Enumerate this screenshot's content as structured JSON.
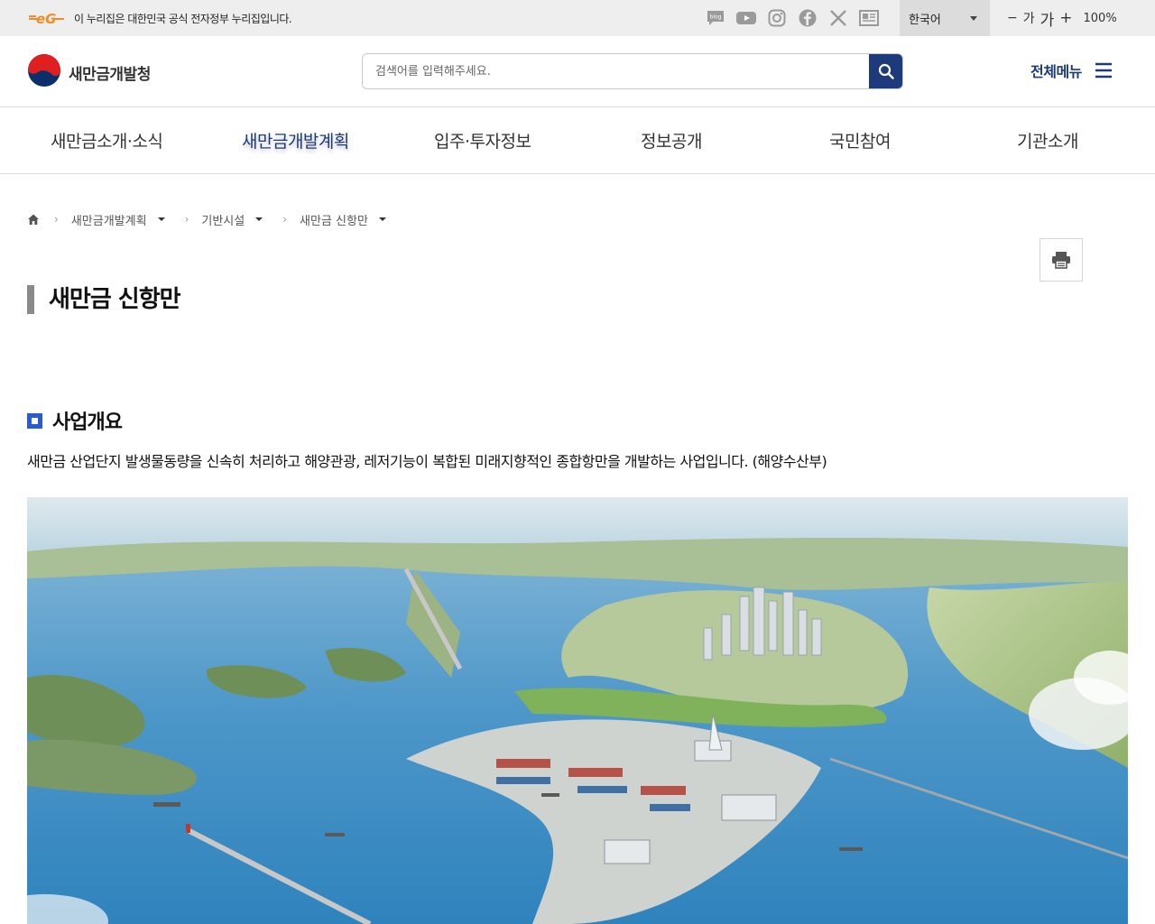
{
  "gov_banner": {
    "logo_text": "eG",
    "text": "이 누리집은 대한민국 공식 전자정부 누리집입니다.",
    "sns_icons": [
      "blog-icon",
      "youtube-icon",
      "instagram-icon",
      "facebook-icon",
      "x-icon",
      "news-icon"
    ],
    "language": "한국어",
    "zoom": {
      "minus": "−",
      "small": "가",
      "large": "가",
      "plus": "+",
      "percent": "100%"
    }
  },
  "header": {
    "site_name": "새만금개발청",
    "search_placeholder": "검색어를 입력해주세요.",
    "all_menu_label": "전체메뉴"
  },
  "gnb": {
    "items": [
      {
        "label": "새만금소개·소식"
      },
      {
        "label": "새만금개발계획"
      },
      {
        "label": "입주·투자정보"
      },
      {
        "label": "정보공개"
      },
      {
        "label": "국민참여"
      },
      {
        "label": "기관소개"
      }
    ],
    "active_index": 1
  },
  "breadcrumb": {
    "items": [
      "새만금개발계획",
      "기반시설",
      "새만금 신항만"
    ]
  },
  "page": {
    "title": "새만금 신항만",
    "section_title": "사업개요",
    "section_desc": "새만금 산업단지 발생물동량을 신속히 처리하고 해양관광, 레저기능이 복합된 미래지향적인 종합항만을 개발하는 사업입니다. (해양수산부)"
  },
  "colors": {
    "brand_navy": "#1d3a7a",
    "section_blue": "#2a5bd0",
    "gov_bar_bg": "#eeeeee"
  }
}
